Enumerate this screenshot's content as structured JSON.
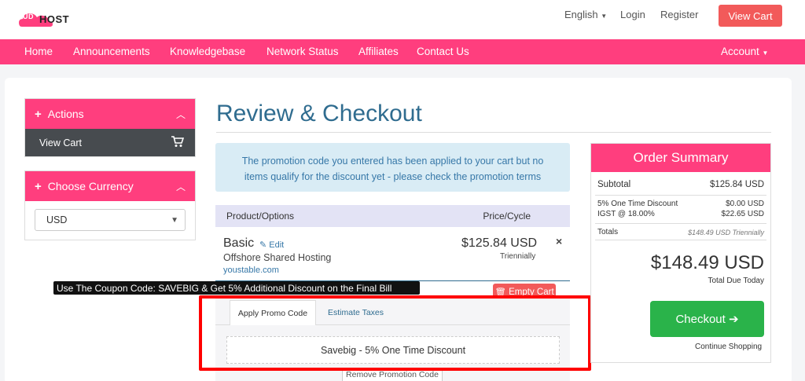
{
  "brand": {
    "name": "HOST",
    "logo_letters": "QLOUD"
  },
  "header": {
    "language": "English",
    "login": "Login",
    "register": "Register",
    "view_cart": "View Cart"
  },
  "nav": {
    "items": [
      "Home",
      "Announcements",
      "Knowledgebase",
      "Network Status",
      "Affiliates",
      "Contact Us"
    ],
    "account": "Account"
  },
  "sidebar": {
    "actions": {
      "title": "Actions",
      "view_cart": "View Cart"
    },
    "currency": {
      "title": "Choose Currency",
      "selected": "USD"
    }
  },
  "page": {
    "title": "Review & Checkout",
    "alert": "The promotion code you entered has been applied to your cart but no items qualify for the discount yet - please check the promotion terms"
  },
  "cart": {
    "col_product": "Product/Options",
    "col_price": "Price/Cycle",
    "item": {
      "name": "Basic",
      "edit": "Edit",
      "description": "Offshore Shared Hosting",
      "domain": "youstable.com",
      "price": "$125.84 USD",
      "cycle": "Triennially"
    },
    "empty_cart": "Empty Cart"
  },
  "banner": "Use The Coupon Code: SAVEBIG & Get 5% Additional Discount on the Final Bill",
  "promo": {
    "tab_apply": "Apply Promo Code",
    "tab_taxes": "Estimate Taxes",
    "applied": "Savebig - 5% One Time Discount",
    "remove": "Remove Promotion Code"
  },
  "summary": {
    "title": "Order Summary",
    "subtotal_label": "Subtotal",
    "subtotal_value": "$125.84 USD",
    "discount_label": "5% One Time Discount",
    "discount_value": "$0.00 USD",
    "tax_label": "IGST @ 18.00%",
    "tax_value": "$22.65 USD",
    "totals_label": "Totals",
    "totals_value": "$148.49 USD Triennially",
    "total": "$148.49 USD",
    "due_label": "Total Due Today",
    "checkout": "Checkout",
    "continue": "Continue Shopping"
  },
  "colors": {
    "brand_pink": "#ff3e7e",
    "title_blue": "#2f6c8f",
    "checkout_green": "#2ab34a",
    "highlight_red": "#ff0000"
  }
}
